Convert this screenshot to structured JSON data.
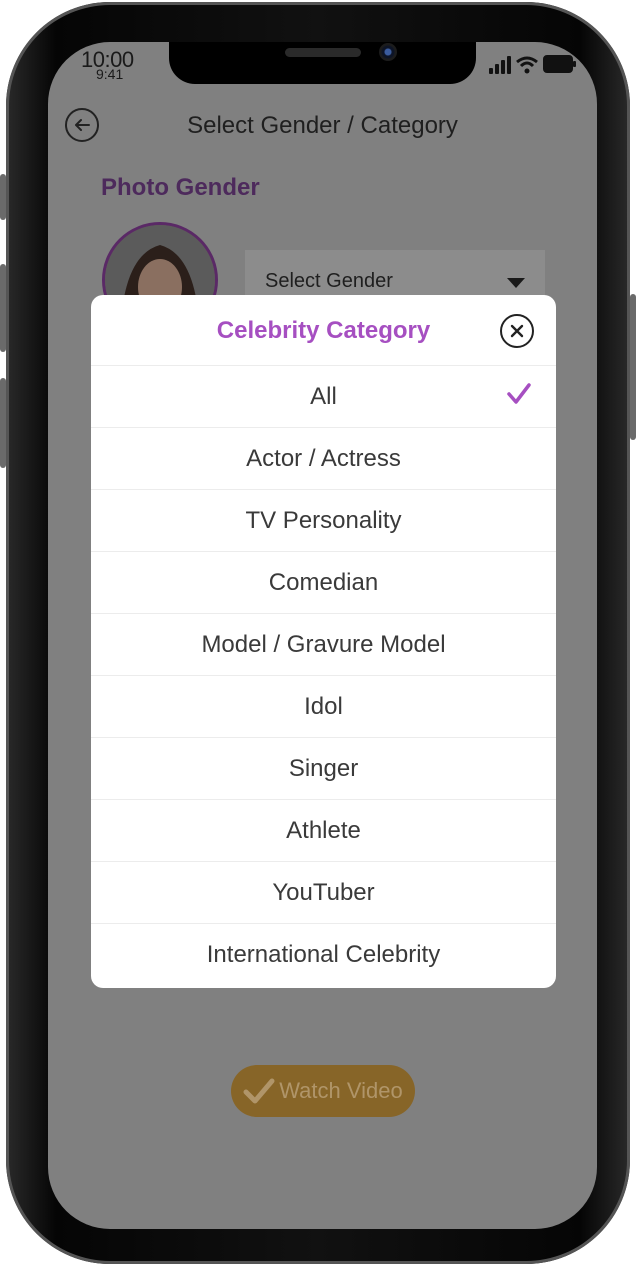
{
  "status_bar": {
    "time_large": "10:00",
    "time_small": "9:41"
  },
  "header": {
    "title": "Select Gender / Category"
  },
  "photo_gender": {
    "label": "Photo Gender"
  },
  "gender_select": {
    "placeholder": "Select Gender"
  },
  "modal": {
    "title": "Celebrity Category",
    "selected": "All",
    "options": [
      "All",
      "Actor / Actress",
      "TV Personality",
      "Comedian",
      "Model / Gravure Model",
      "Idol",
      "Singer",
      "Athlete",
      "YouTuber",
      "International Celebrity"
    ]
  },
  "watch_button": {
    "label": "Watch Video"
  },
  "colors": {
    "accent": "#a64fc1",
    "dim_overlay": "#808080",
    "watch_button": "#876528"
  }
}
